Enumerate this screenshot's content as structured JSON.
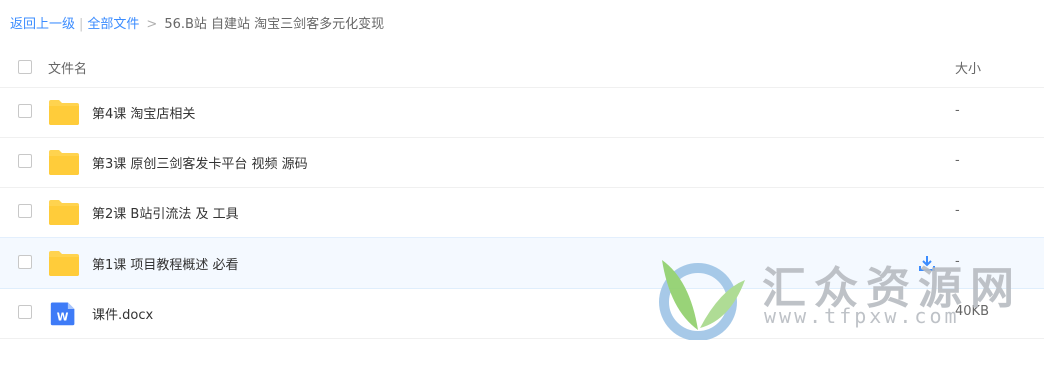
{
  "breadcrumb": {
    "back": "返回上一级",
    "separator": "|",
    "all_files": "全部文件",
    "arrow": ">",
    "current": "56.B站 自建站 淘宝三剑客多元化变现"
  },
  "header": {
    "name": "文件名",
    "size": "大小"
  },
  "files": [
    {
      "name": "第4课 淘宝店相关",
      "size": "-",
      "icon": "folder-icon"
    },
    {
      "name": "第3课 原创三剑客发卡平台 视频 源码",
      "size": "-",
      "icon": "folder-icon"
    },
    {
      "name": "第2课 B站引流法 及 工具",
      "size": "-",
      "icon": "folder-icon"
    },
    {
      "name": "第1课 项目教程概述 必看",
      "size": "-",
      "icon": "folder-icon"
    },
    {
      "name": "课件.docx",
      "size": "40KB",
      "icon": "word-doc-icon"
    }
  ],
  "watermark": {
    "title": "汇众资源网",
    "url": "www.tfpxw.com"
  },
  "colors": {
    "link": "#3b8cff",
    "folder": "#ffd34f",
    "hover_row": "#f4f9ff",
    "word": "#3e7bf7"
  }
}
